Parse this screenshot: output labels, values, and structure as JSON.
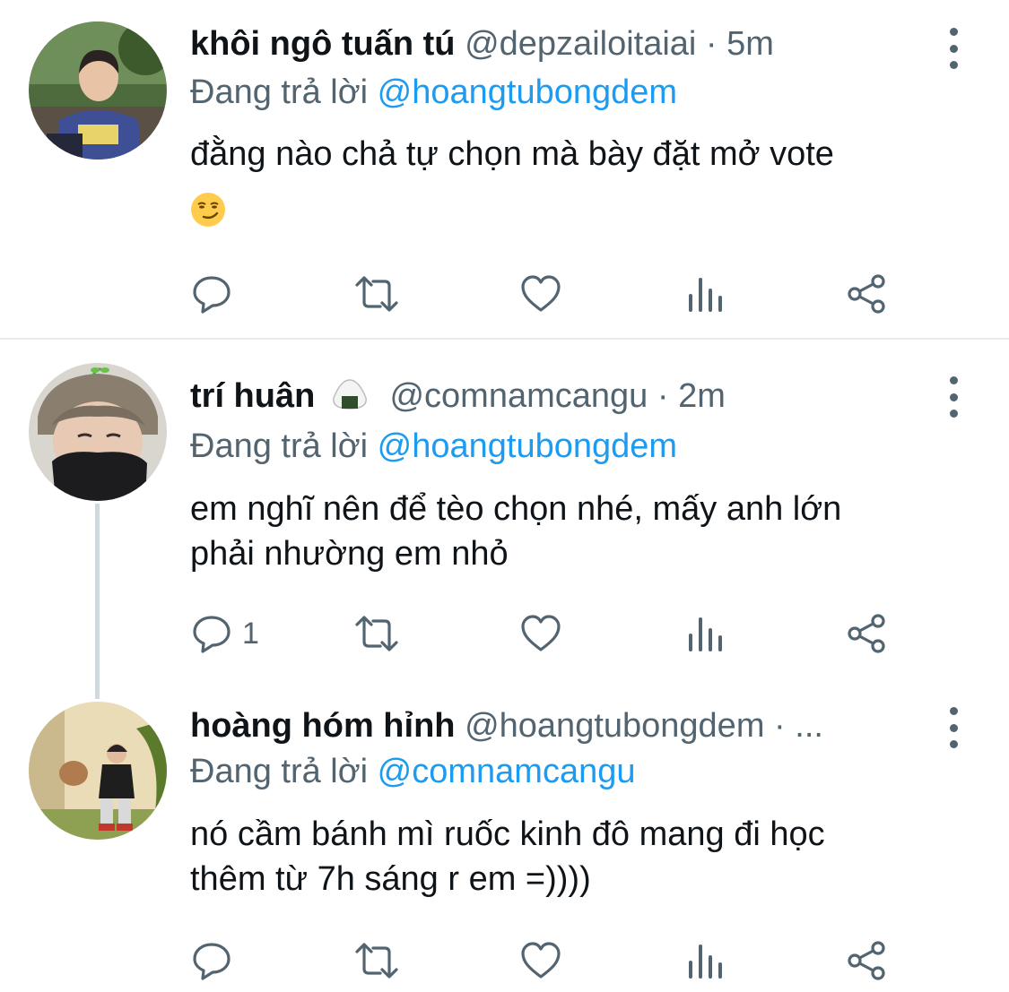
{
  "tweets": [
    {
      "name": "khôi ngô tuấn tú",
      "name_emoji": "",
      "handle": "@depzailoitaiai",
      "dot": "·",
      "time": "5m",
      "reply_prefix": "Đang trả lời",
      "reply_to": "@hoangtubongdem",
      "lines": [
        "đằng nào chả tự chọn mà bày đặt mở vote",
        ""
      ],
      "emoji": "smirking-face",
      "reply_count": ""
    },
    {
      "name": "trí huân",
      "name_emoji": "rice-ball",
      "handle": "@comnamcangu",
      "dot": "·",
      "time": "2m",
      "reply_prefix": "Đang trả lời",
      "reply_to": "@hoangtubongdem",
      "lines": [
        "em nghĩ nên để tèo chọn nhé, mấy anh lớn",
        "phải nhường em nhỏ"
      ],
      "reply_count": "1"
    },
    {
      "name": "hoàng hóm hỉnh",
      "handle": "@hoangtubongdem",
      "dot": "·",
      "time": "...",
      "reply_prefix": "Đang trả lời",
      "reply_to": "@comnamcangu",
      "lines": [
        "nó cầm bánh mì ruốc kinh đô mang đi học",
        "thêm từ 7h sáng r em =))))"
      ],
      "reply_count": ""
    }
  ],
  "icons": [
    "reply-icon",
    "retweet-icon",
    "like-icon",
    "analytics-icon",
    "share-icon",
    "more-icon"
  ],
  "colors": {
    "text": "#0f1419",
    "muted": "#536471",
    "accent": "#1d9bf0",
    "divider": "#e7e9ea"
  }
}
